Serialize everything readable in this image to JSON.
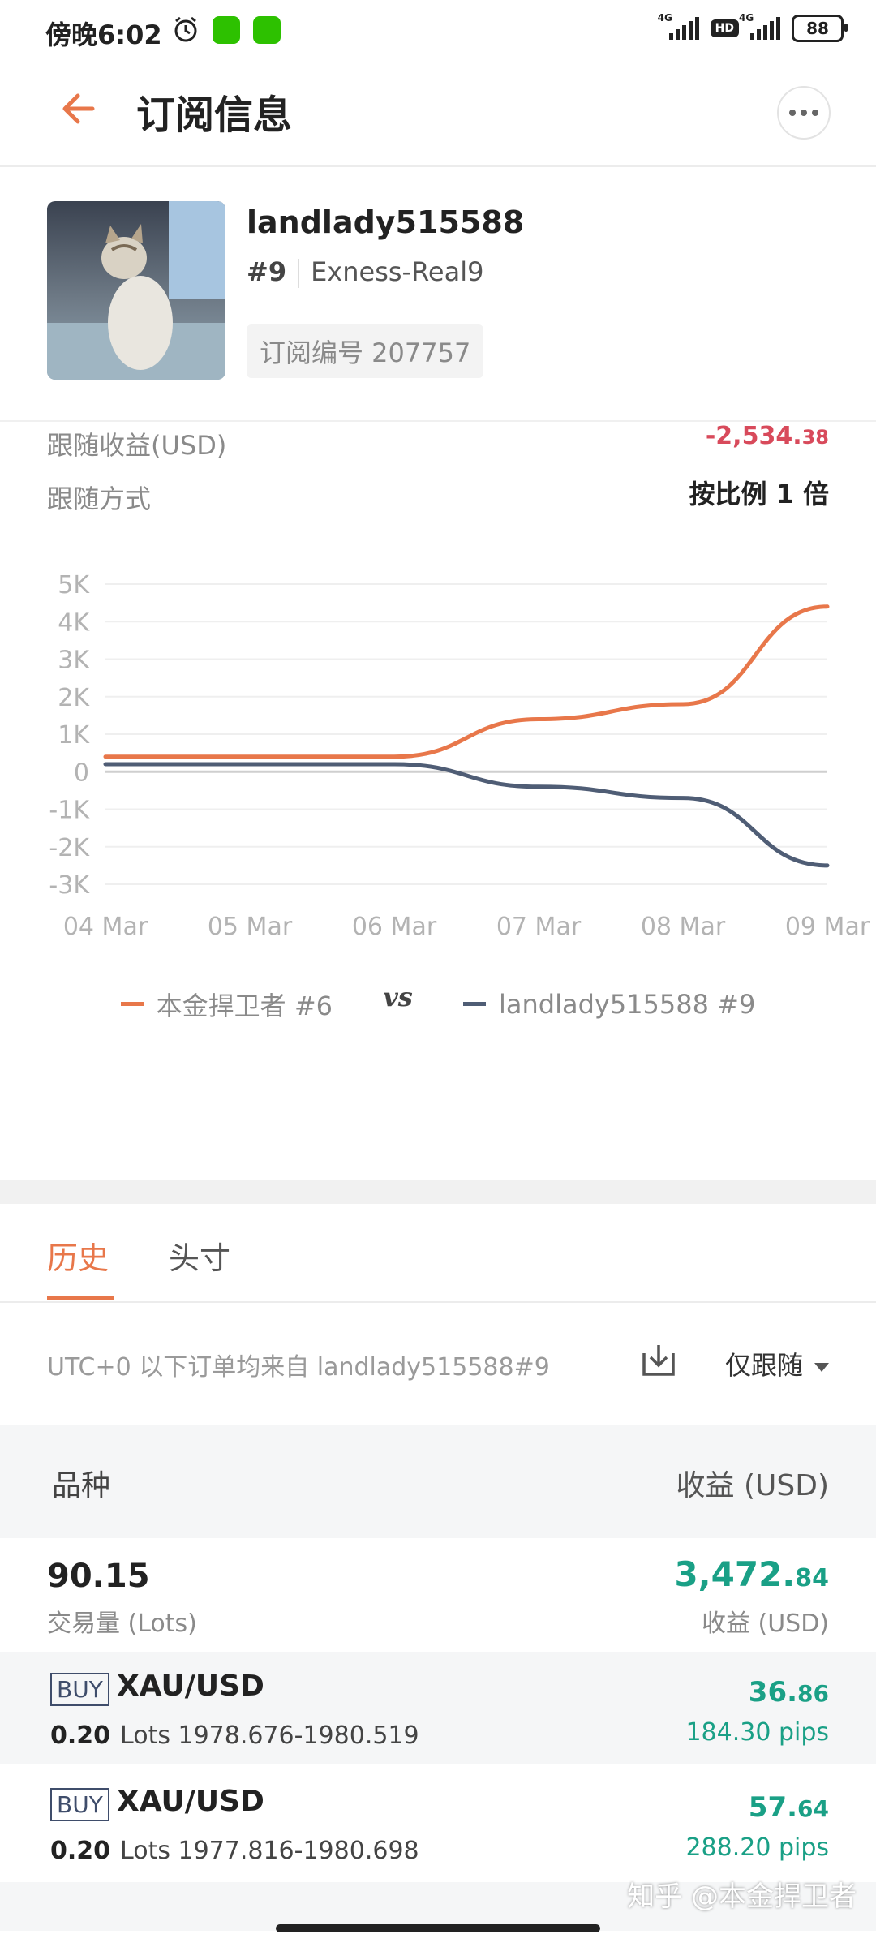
{
  "status_bar": {
    "time": "傍晚6:02",
    "network1": "4G",
    "hd": "HD",
    "network2": "4G",
    "battery": "88"
  },
  "header": {
    "title": "订阅信息"
  },
  "profile": {
    "username": "landlady515588",
    "rank": "#9",
    "server": "Exness-Real9",
    "subscription": "订阅编号 207757"
  },
  "stats": {
    "follow_profit_label": "跟随收益(USD)",
    "follow_profit_main": "-2,534.",
    "follow_profit_decimal": "38",
    "follow_mode_label": "跟随方式",
    "follow_mode_value": "按比例 1 倍"
  },
  "colors": {
    "accent": "#e8774a",
    "profit_negative": "#d84a5b",
    "profit_positive": "#1aa086",
    "series_b": "#4f5d75"
  },
  "chart_data": {
    "type": "line",
    "categories": [
      "04 Mar",
      "05 Mar",
      "06 Mar",
      "07 Mar",
      "08 Mar",
      "09 Mar"
    ],
    "y_ticks": [
      "5K",
      "4K",
      "3K",
      "2K",
      "1K",
      "0",
      "-1K",
      "-2K",
      "-3K"
    ],
    "ylim": [
      -3000,
      5000
    ],
    "series": [
      {
        "name": "本金捍卫者 #6",
        "color": "#e8774a",
        "values": [
          400,
          400,
          400,
          1400,
          1800,
          4400
        ]
      },
      {
        "name": "landlady515588 #9",
        "color": "#4f5d75",
        "values": [
          200,
          200,
          200,
          -400,
          -700,
          -2500
        ]
      }
    ],
    "legend_vs": "vs",
    "legend_position": "bottom-center",
    "grid": true
  },
  "tabs": [
    {
      "label": "历史",
      "active": true
    },
    {
      "label": "头寸",
      "active": false
    }
  ],
  "filter": {
    "info": "UTC+0 以下订单均来自 landlady515588#9",
    "select_value": "仅跟随"
  },
  "table": {
    "col_symbol": "品种",
    "col_profit": "收益 (USD)"
  },
  "summary": {
    "lots": "90.15",
    "lots_label": "交易量 (Lots)",
    "profit_main": "3,472.",
    "profit_decimal": "84",
    "profit_label": "收益 (USD)"
  },
  "trades": [
    {
      "side": "BUY",
      "symbol": "XAU/USD",
      "lots": "0.20",
      "detail": "Lots 1978.676-1980.519",
      "profit_main": "36.",
      "profit_decimal": "86",
      "pips": "184.30 pips"
    },
    {
      "side": "BUY",
      "symbol": "XAU/USD",
      "lots": "0.20",
      "detail": "Lots 1977.816-1980.698",
      "profit_main": "57.",
      "profit_decimal": "64",
      "pips": "288.20 pips"
    }
  ],
  "watermark": "知乎 @本金捍卫者"
}
